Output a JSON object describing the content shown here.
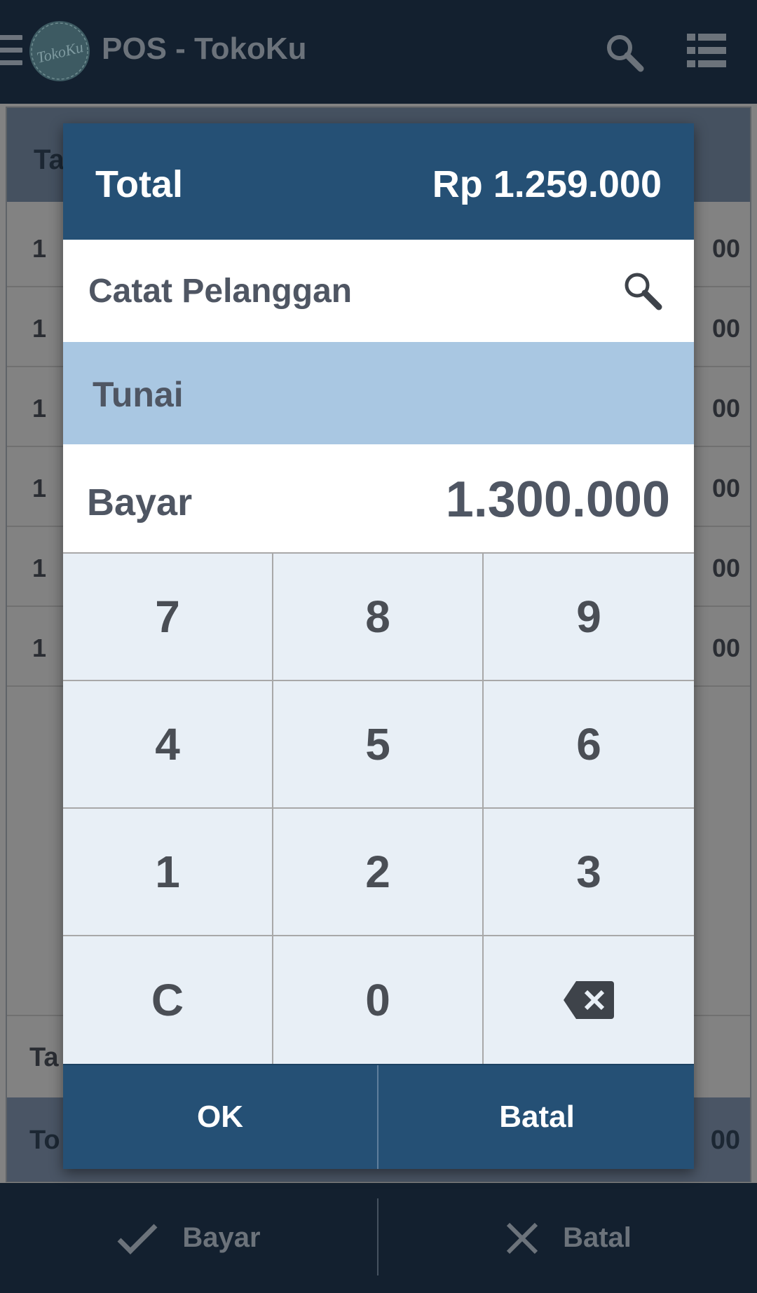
{
  "appbar": {
    "title": "POS - TokoKu",
    "logo_text": "TokoKu"
  },
  "background": {
    "rows": [
      {
        "qty": "1",
        "amount": "00"
      },
      {
        "qty": "1",
        "amount": "00"
      },
      {
        "qty": "1",
        "amount": "00"
      },
      {
        "qty": "1",
        "amount": "00"
      },
      {
        "qty": "1",
        "amount": "00"
      },
      {
        "qty": "1",
        "amount": "00"
      }
    ],
    "header_label": "Ta",
    "tax_label": "Ta",
    "total_label": "To",
    "total_amount": "00"
  },
  "bottombar": {
    "pay_label": "Bayar",
    "cancel_label": "Batal"
  },
  "dialog": {
    "total_label": "Total",
    "total_amount": "Rp 1.259.000",
    "customer_label": "Catat Pelanggan",
    "method_label": "Tunai",
    "pay_label": "Bayar",
    "pay_value": "1.300.000",
    "keys": [
      "7",
      "8",
      "9",
      "4",
      "5",
      "6",
      "1",
      "2",
      "3",
      "C",
      "0"
    ],
    "ok_label": "OK",
    "cancel_label": "Batal"
  },
  "colors": {
    "appbar": "#13202f",
    "dialog_header": "#255075",
    "method_selected": "#a9c7e2",
    "keypad": "#e8eff6"
  }
}
